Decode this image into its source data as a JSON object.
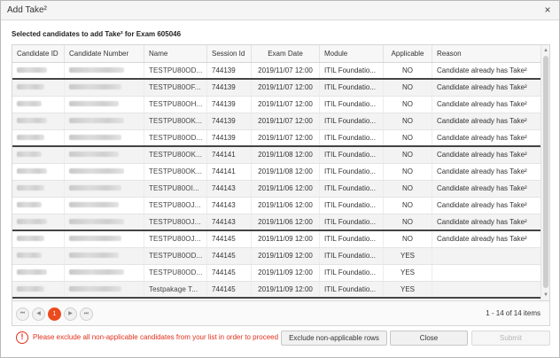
{
  "window": {
    "title": "Add Take²",
    "close_glyph": "×",
    "subtitle": "Selected candidates to add Take² for Exam 605046"
  },
  "grid": {
    "columns": [
      "Candidate ID",
      "Candidate Number",
      "Name",
      "Session Id",
      "Exam Date",
      "Module",
      "Applicable",
      "Reason"
    ],
    "rows": [
      {
        "name": "TESTPU80OD...",
        "session": "744139",
        "date": "2019/11/07 12:00",
        "module": "ITIL Foundatio...",
        "applicable": "NO",
        "reason": "Candidate already has Take²"
      },
      {
        "name": "TESTPU80OF...",
        "session": "744139",
        "date": "2019/11/07 12:00",
        "module": "ITIL Foundatio...",
        "applicable": "NO",
        "reason": "Candidate already has Take²"
      },
      {
        "name": "TESTPU80OH...",
        "session": "744139",
        "date": "2019/11/07 12:00",
        "module": "ITIL Foundatio...",
        "applicable": "NO",
        "reason": "Candidate already has Take²"
      },
      {
        "name": "TESTPU80OK...",
        "session": "744139",
        "date": "2019/11/07 12:00",
        "module": "ITIL Foundatio...",
        "applicable": "NO",
        "reason": "Candidate already has Take²"
      },
      {
        "name": "TESTPU80OD...",
        "session": "744139",
        "date": "2019/11/07 12:00",
        "module": "ITIL Foundatio...",
        "applicable": "NO",
        "reason": "Candidate already has Take²"
      },
      {
        "name": "TESTPU80OK...",
        "session": "744141",
        "date": "2019/11/08 12:00",
        "module": "ITIL Foundatio...",
        "applicable": "NO",
        "reason": "Candidate already has Take²"
      },
      {
        "name": "TESTPU80OK...",
        "session": "744141",
        "date": "2019/11/08 12:00",
        "module": "ITIL Foundatio...",
        "applicable": "NO",
        "reason": "Candidate already has Take²"
      },
      {
        "name": "TESTPU80OI...",
        "session": "744143",
        "date": "2019/11/06 12:00",
        "module": "ITIL Foundatio...",
        "applicable": "NO",
        "reason": "Candidate already has Take²"
      },
      {
        "name": "TESTPU80OJ...",
        "session": "744143",
        "date": "2019/11/06 12:00",
        "module": "ITIL Foundatio...",
        "applicable": "NO",
        "reason": "Candidate already has Take²"
      },
      {
        "name": "TESTPU80OJ...",
        "session": "744143",
        "date": "2019/11/06 12:00",
        "module": "ITIL Foundatio...",
        "applicable": "NO",
        "reason": "Candidate already has Take²"
      },
      {
        "name": "TESTPU80OJ...",
        "session": "744145",
        "date": "2019/11/09 12:00",
        "module": "ITIL Foundatio...",
        "applicable": "NO",
        "reason": "Candidate already has Take²"
      },
      {
        "name": "TESTPU80OD...",
        "session": "744145",
        "date": "2019/11/09 12:00",
        "module": "ITIL Foundatio...",
        "applicable": "YES",
        "reason": ""
      },
      {
        "name": "TESTPU80OD...",
        "session": "744145",
        "date": "2019/11/09 12:00",
        "module": "ITIL Foundatio...",
        "applicable": "YES",
        "reason": ""
      },
      {
        "name": "Testpakage T...",
        "session": "744145",
        "date": "2019/11/09 12:00",
        "module": "ITIL Foundatio...",
        "applicable": "YES",
        "reason": ""
      }
    ]
  },
  "pager": {
    "first_icon": "first-page-icon",
    "prev_icon": "prev-page-icon",
    "next_icon": "next-page-icon",
    "last_icon": "last-page-icon",
    "first_glyph": "⏮",
    "prev_glyph": "◀",
    "next_glyph": "▶",
    "last_glyph": "⏭",
    "current_page": "1",
    "info": "1 - 14 of 14 items"
  },
  "footer": {
    "warning_glyph": "!",
    "message": "Please exclude all non-applicable candidates from your list in order to proceed",
    "exclude_label": "Exclude non-applicable rows",
    "close_label": "Close",
    "submit_label": "Submit"
  },
  "colors": {
    "accent": "#ec4a1f",
    "warning": "#e0301e"
  }
}
